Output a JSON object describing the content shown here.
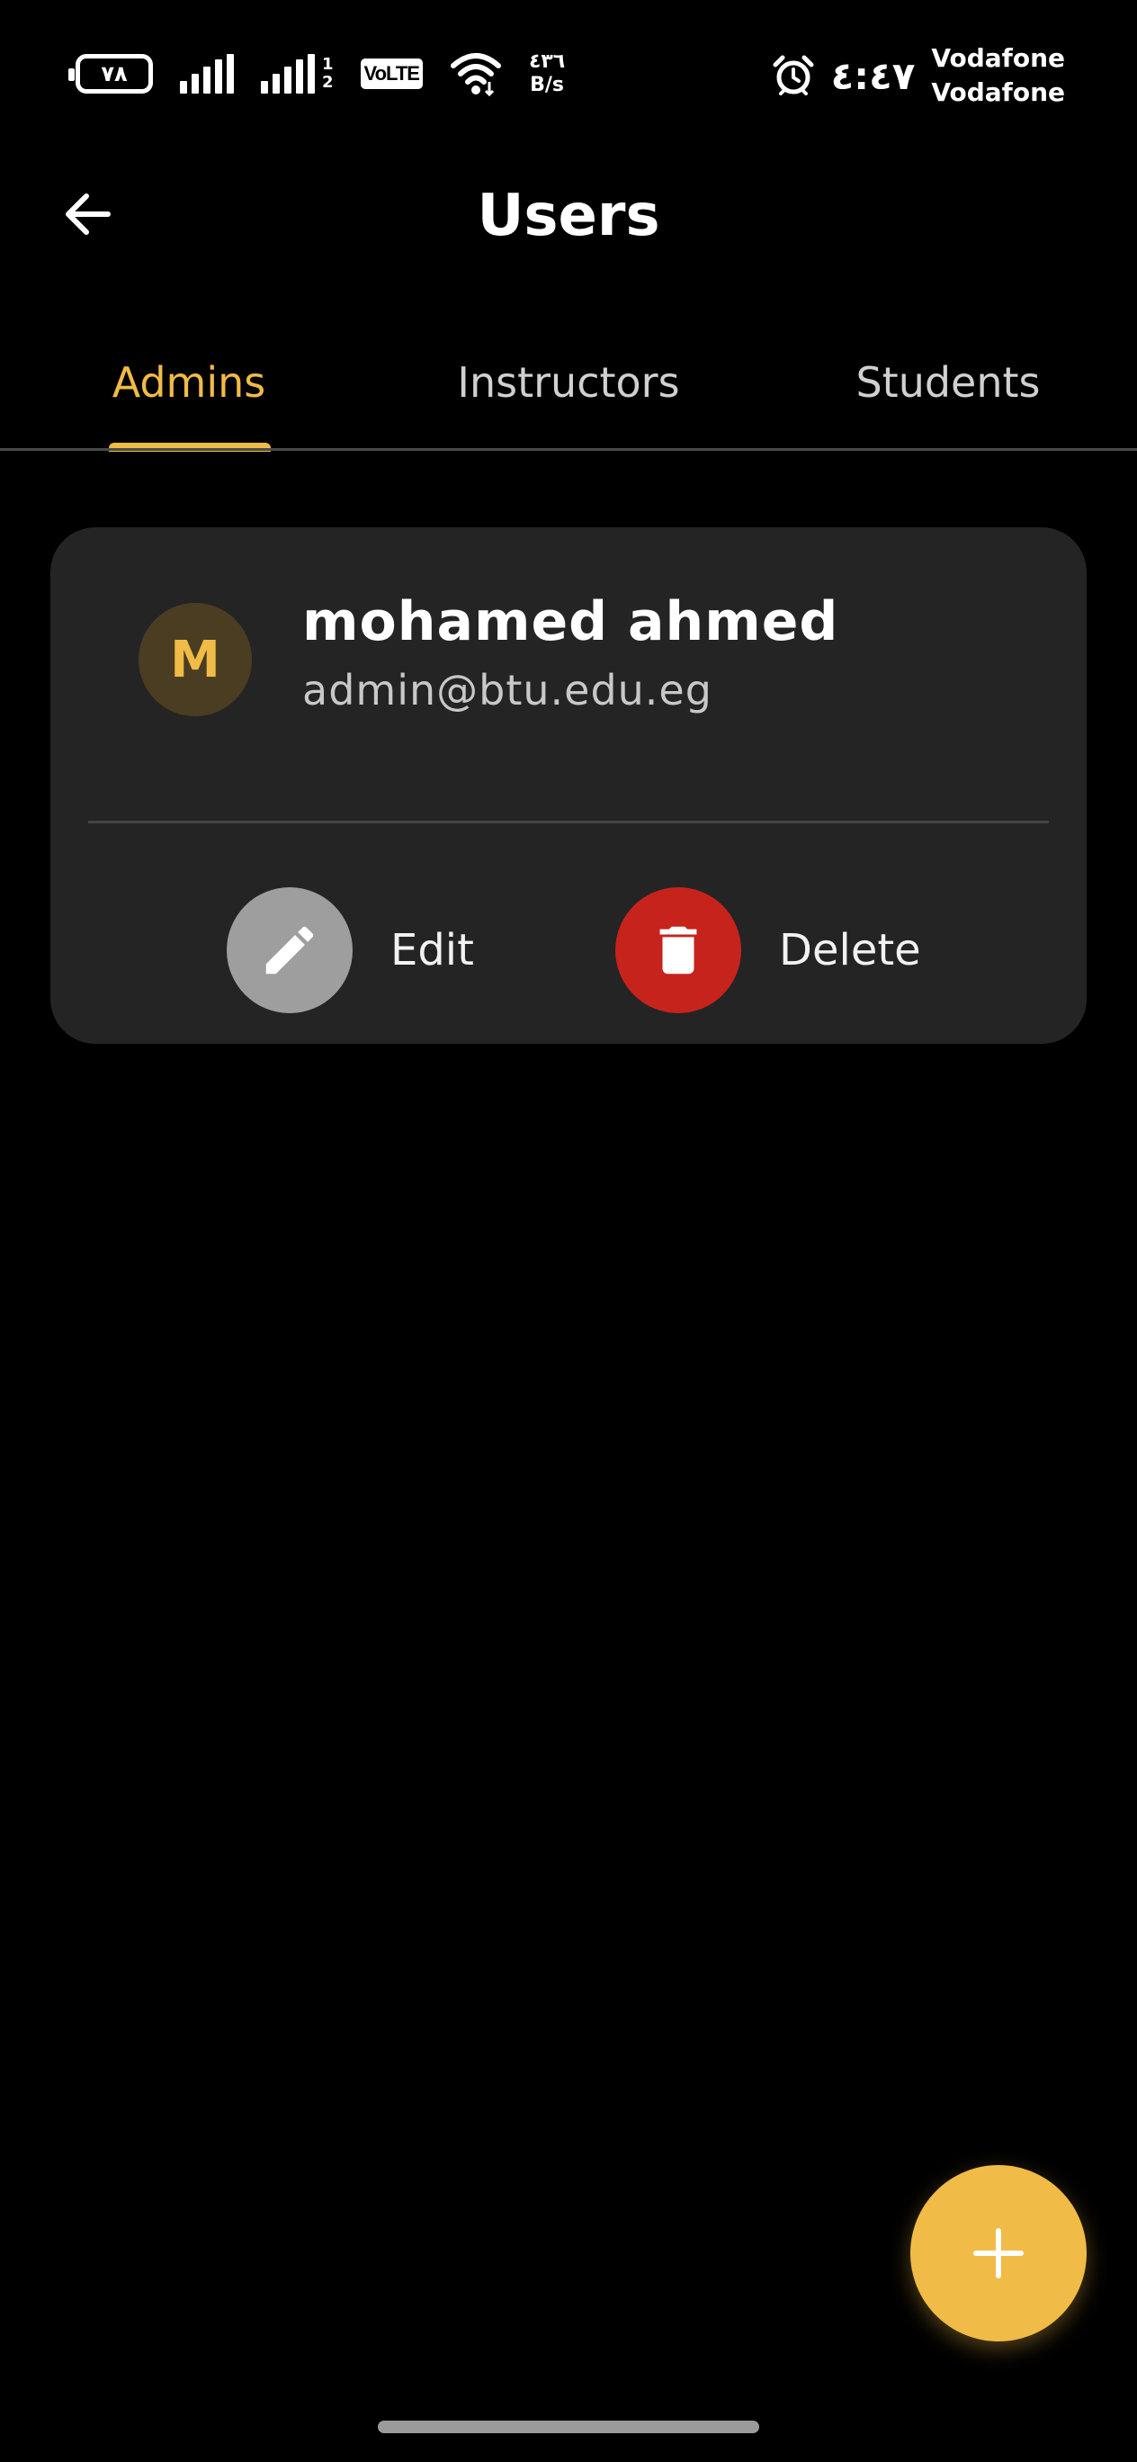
{
  "status_bar": {
    "battery": "٧٨",
    "sim_index": [
      "1",
      "2"
    ],
    "volte": "VoLTE",
    "net_speed_value": "٤٣٦",
    "net_speed_unit": "B/s",
    "time": "٤:٤٧",
    "carriers": [
      "Vodafone",
      "Vodafone"
    ]
  },
  "app_bar": {
    "title": "Users",
    "back_icon": "arrow-left-icon"
  },
  "tabs": [
    {
      "label": "Admins",
      "selected": true
    },
    {
      "label": "Instructors",
      "selected": false
    },
    {
      "label": "Students",
      "selected": false
    }
  ],
  "users": [
    {
      "initial": "M",
      "name": "mohamed ahmed",
      "email": "admin@btu.edu.eg",
      "actions": {
        "edit": {
          "label": "Edit",
          "icon": "pencil-icon"
        },
        "delete": {
          "label": "Delete",
          "icon": "trash-icon"
        }
      }
    }
  ],
  "fab": {
    "icon": "plus-icon"
  },
  "colors": {
    "accent": "#f0bb46",
    "background": "#000000",
    "card": "#242424",
    "delete": "#c6231c",
    "edit": "#9e9e9e"
  }
}
